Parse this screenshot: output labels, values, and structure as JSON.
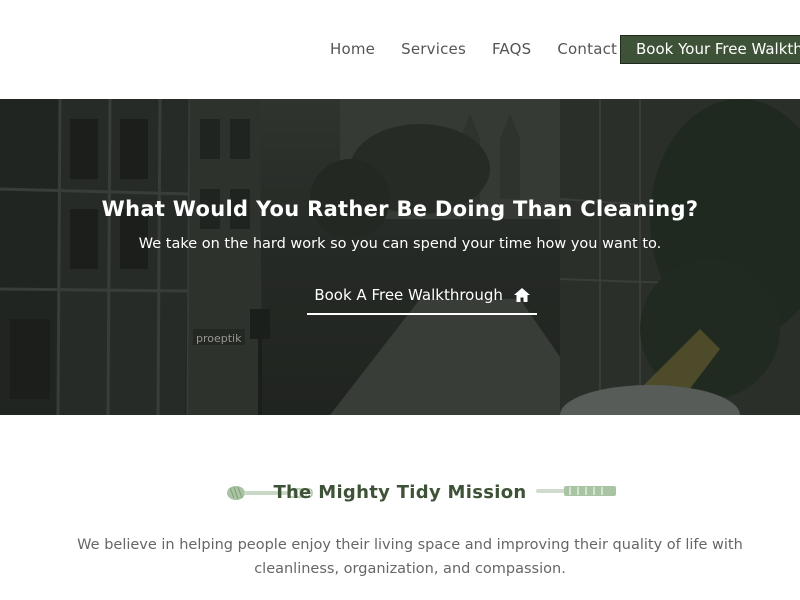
{
  "nav": {
    "items": [
      "Home",
      "Services",
      "FAQS",
      "Contact"
    ],
    "cta_label": "Book Your Free Walkthrough"
  },
  "hero": {
    "title": "What Would You Rather Be Doing Than Cleaning?",
    "subtitle": "We take on the hard work so you can spend your time how you want to.",
    "button_label": "Book A Free Walkthrough",
    "button_icon": "home-icon",
    "shop_sign": "proeptik"
  },
  "mission": {
    "title": "The Mighty Tidy Mission",
    "text": "We believe in helping people enjoy their living space and improving their quality of life with cleanliness, organization, and compassion."
  },
  "colors": {
    "brand_green": "#3e5237",
    "accent_sage": "#a8c4a2"
  }
}
